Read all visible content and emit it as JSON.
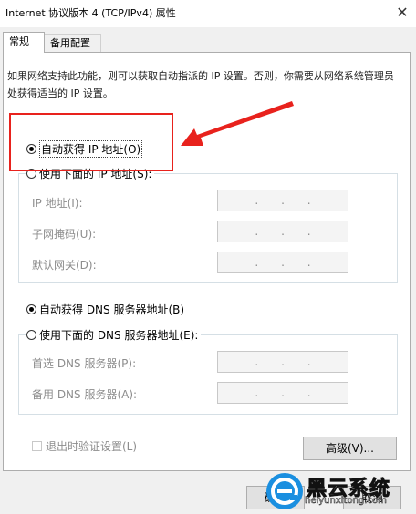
{
  "window": {
    "title": "Internet 协议版本 4 (TCP/IPv4) 属性",
    "close_glyph": "✕"
  },
  "tabs": [
    {
      "label": "常规",
      "active": true
    },
    {
      "label": "备用配置",
      "active": false
    }
  ],
  "description": "如果网络支持此功能，则可以获取自动指派的 IP 设置。否则，你需要从网络系统管理员处获得适当的 IP 设置。",
  "ip_section": {
    "auto_label": "自动获得 IP 地址(O)",
    "manual_label": "使用下面的 IP 地址(S):",
    "selected": "auto",
    "fields": [
      {
        "label": "IP 地址(I):",
        "value": ".   .   ."
      },
      {
        "label": "子网掩码(U):",
        "value": ".   .   ."
      },
      {
        "label": "默认网关(D):",
        "value": ".   .   ."
      }
    ]
  },
  "dns_section": {
    "auto_label": "自动获得 DNS 服务器地址(B)",
    "manual_label": "使用下面的 DNS 服务器地址(E):",
    "selected": "auto",
    "fields": [
      {
        "label": "首选 DNS 服务器(P):",
        "value": ".   .   ."
      },
      {
        "label": "备用 DNS 服务器(A):",
        "value": ".   .   ."
      }
    ]
  },
  "validate_checkbox": {
    "label": "退出时验证设置(L)",
    "checked": false
  },
  "buttons": {
    "advanced": "高级(V)...",
    "ok": "确定",
    "cancel": "取消"
  },
  "watermark": {
    "main_text": "黑云系统",
    "sub_text": "heiyunxitong.com"
  },
  "colors": {
    "annotation_red": "#e8221d",
    "disabled_text": "#8d8d8d",
    "watermark_blue": "#1a8fe0"
  }
}
